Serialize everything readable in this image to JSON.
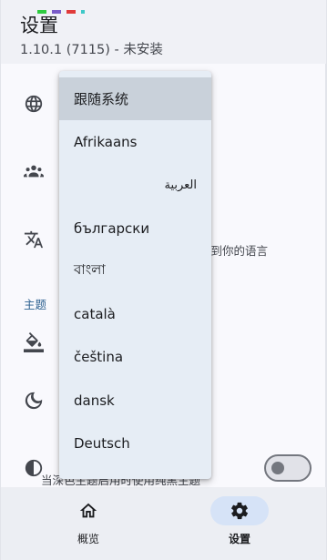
{
  "header": {
    "title": "设置",
    "subtitle": "1.10.1 (7115) - 未安装"
  },
  "status_colors": [
    "#2ecc40",
    "#7a5cc8",
    "#e03a3a",
    "#3ec8c8"
  ],
  "settings": {
    "rows": [
      {
        "icon": "globe-icon"
      },
      {
        "icon": "people-icon"
      },
      {
        "icon": "translate-icon",
        "partial_text": "择到你的语言"
      },
      {
        "icon": "paint-bucket-icon"
      },
      {
        "icon": "moon-icon"
      },
      {
        "icon": "contrast-icon",
        "partial_text": "当深色主题启用时使用纯黑主题",
        "toggle_on": false
      }
    ],
    "section_theme": "主题"
  },
  "language_menu": {
    "items": [
      {
        "label": "跟随系统",
        "selected": true
      },
      {
        "label": "Afrikaans"
      },
      {
        "label": "العربية",
        "rtl": true
      },
      {
        "label": "български"
      },
      {
        "label": "বাংলা"
      },
      {
        "label": "català"
      },
      {
        "label": "čeština"
      },
      {
        "label": "dansk"
      },
      {
        "label": "Deutsch"
      }
    ]
  },
  "bottom_nav": {
    "items": [
      {
        "label": "概览",
        "icon": "home-icon",
        "active": false
      },
      {
        "label": "设置",
        "icon": "gear-icon",
        "active": true
      }
    ]
  },
  "colors": {
    "accent": "#2a5f8f",
    "nav_active_pill": "#d6e3f7",
    "menu_bg": "#e6edf5",
    "menu_selected": "#c9d1da"
  }
}
